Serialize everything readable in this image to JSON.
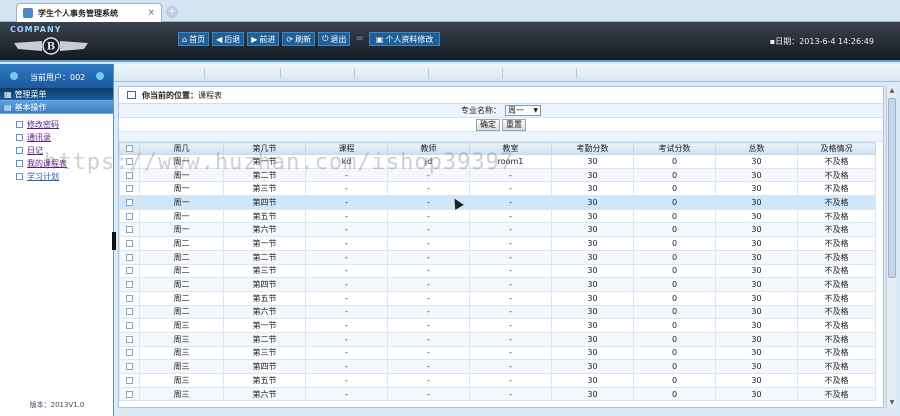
{
  "browser": {
    "tab_title": "学生个人事务管理系统",
    "close": "×",
    "new_tab": "+"
  },
  "header": {
    "company": "COMPANY",
    "nav": [
      {
        "icon": "home-icon",
        "glyph": "⌂",
        "label": "首页"
      },
      {
        "icon": "arrow-left-icon",
        "glyph": "◀",
        "label": "后退"
      },
      {
        "icon": "arrow-right-icon",
        "glyph": "▶",
        "label": "前进"
      },
      {
        "icon": "refresh-icon",
        "glyph": "⟳",
        "label": "刷新"
      },
      {
        "icon": "power-icon",
        "glyph": "⏻",
        "label": "退出"
      }
    ],
    "separator": "=",
    "extra": {
      "icon": "window-icon",
      "glyph": "▣",
      "label": "个人资料修改"
    },
    "datetime": "▪日期：2013-6-4 14:26:49"
  },
  "sidebar": {
    "user": "当前用户：002",
    "manage_menu": "管理菜单",
    "section": "基本操作",
    "items": [
      "修改密码",
      "通讯录",
      "日记",
      "我的课程表",
      "学习计划"
    ],
    "version": "版本：2013V1.0"
  },
  "content": {
    "crumb_label": "你当前的位置：",
    "crumb_value": "课程表",
    "filter_label": "专业名称：",
    "filter_value": "周一",
    "confirm": "确定",
    "reset": "重置",
    "columns": [
      "周几",
      "第几节",
      "课程",
      "教师",
      "教室",
      "考勤分数",
      "考试分数",
      "总数",
      "及格情况"
    ],
    "rows": [
      [
        "周一",
        "第一节",
        "kd",
        "jd",
        "room1",
        "30",
        "0",
        "30",
        "不及格"
      ],
      [
        "周一",
        "第二节",
        "-",
        "-",
        "-",
        "30",
        "0",
        "30",
        "不及格"
      ],
      [
        "周一",
        "第三节",
        "-",
        "-",
        "-",
        "30",
        "0",
        "30",
        "不及格"
      ],
      [
        "周一",
        "第四节",
        "-",
        "-",
        "-",
        "30",
        "0",
        "30",
        "不及格"
      ],
      [
        "周一",
        "第五节",
        "-",
        "-",
        "-",
        "30",
        "0",
        "30",
        "不及格"
      ],
      [
        "周一",
        "第六节",
        "-",
        "-",
        "-",
        "30",
        "0",
        "30",
        "不及格"
      ],
      [
        "周二",
        "第一节",
        "-",
        "-",
        "-",
        "30",
        "0",
        "30",
        "不及格"
      ],
      [
        "周二",
        "第二节",
        "-",
        "-",
        "-",
        "30",
        "0",
        "30",
        "不及格"
      ],
      [
        "周二",
        "第三节",
        "-",
        "-",
        "-",
        "30",
        "0",
        "30",
        "不及格"
      ],
      [
        "周二",
        "第四节",
        "-",
        "-",
        "-",
        "30",
        "0",
        "30",
        "不及格"
      ],
      [
        "周二",
        "第五节",
        "-",
        "-",
        "-",
        "30",
        "0",
        "30",
        "不及格"
      ],
      [
        "周二",
        "第六节",
        "-",
        "-",
        "-",
        "30",
        "0",
        "30",
        "不及格"
      ],
      [
        "周三",
        "第一节",
        "-",
        "-",
        "-",
        "30",
        "0",
        "30",
        "不及格"
      ],
      [
        "周三",
        "第二节",
        "-",
        "-",
        "-",
        "30",
        "0",
        "30",
        "不及格"
      ],
      [
        "周三",
        "第三节",
        "-",
        "-",
        "-",
        "30",
        "0",
        "30",
        "不及格"
      ],
      [
        "周三",
        "第四节",
        "-",
        "-",
        "-",
        "30",
        "0",
        "30",
        "不及格"
      ],
      [
        "周三",
        "第五节",
        "-",
        "-",
        "-",
        "30",
        "0",
        "30",
        "不及格"
      ],
      [
        "周三",
        "第六节",
        "-",
        "-",
        "-",
        "30",
        "0",
        "30",
        "不及格"
      ]
    ],
    "highlighted_row": 3
  },
  "watermark": "https://www.huzhan.com/ishop39397"
}
